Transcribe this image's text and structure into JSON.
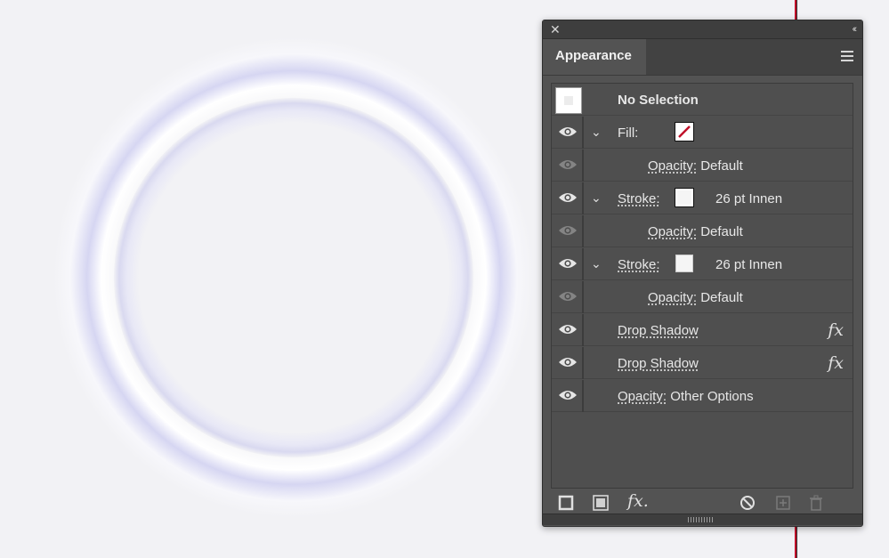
{
  "panel": {
    "tab_title": "Appearance",
    "header_label": "No Selection",
    "rows": [
      {
        "label": "Fill:",
        "extra": ""
      },
      {
        "label": "Opacity:",
        "extra": "Default"
      },
      {
        "label": "Stroke:",
        "extra": "26 pt  Innen"
      },
      {
        "label": "Opacity:",
        "extra": "Default"
      },
      {
        "label": "Stroke:",
        "extra": "26 pt  Innen"
      },
      {
        "label": "Opacity:",
        "extra": "Default"
      },
      {
        "label": "Drop Shadow",
        "extra": ""
      },
      {
        "label": "Drop Shadow",
        "extra": ""
      },
      {
        "label": "Opacity:",
        "extra": "Other Options"
      }
    ],
    "fx_glyph": "fx",
    "footer_fx_glyph": "fx."
  },
  "icons": {
    "close": "close-icon",
    "collapse": "double-chevron-left-icon",
    "menu": "hamburger-menu-icon",
    "visibility": "eye-icon",
    "expand": "chevron-down-icon",
    "effect": "fx-icon",
    "add_stroke": "square-outline-icon",
    "add_fill": "filled-square-icon",
    "add_effect": "fx-menu-icon",
    "clear": "no-symbol-icon",
    "duplicate": "add-item-icon",
    "delete": "trash-icon"
  },
  "colors": {
    "accent_red": "#c0102a",
    "canvas_bg": "#f2f2f5",
    "ring_glow": "#c8c8ec"
  }
}
